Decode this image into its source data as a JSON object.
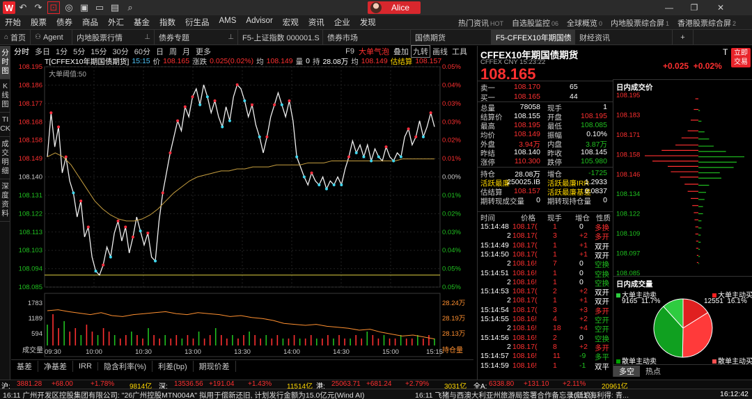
{
  "window": {
    "user_name": "Alice"
  },
  "menu": [
    "开始",
    "股票",
    "债券",
    "商品",
    "外汇",
    "基金",
    "指数",
    "衍生品",
    "AMS",
    "Advisor",
    "宏观",
    "资讯",
    "企业",
    "发现"
  ],
  "quick_links": [
    {
      "label": "热门资讯",
      "badge": "HOT"
    },
    {
      "label": "自选股监控",
      "badge": "06"
    },
    {
      "label": "全球概览",
      "badge": "0"
    },
    {
      "label": "内地股票综合屏",
      "badge": "1"
    },
    {
      "label": "香港股票综合屏",
      "badge": "2"
    }
  ],
  "tabs": [
    {
      "label": "首页",
      "icon": "home-icon"
    },
    {
      "label": "Agent",
      "icon": "user-icon"
    },
    {
      "label": "内地股票行情",
      "pin": true
    },
    {
      "label": "债券专题",
      "pin": true
    },
    {
      "label": "F5-上证指数 000001.S"
    },
    {
      "label": "债券市场"
    },
    {
      "label": "国债期货"
    },
    {
      "label": "F5-CFFEX10年期国债"
    },
    {
      "label": "财经资讯"
    }
  ],
  "vtabs": [
    "分时图",
    "K线图",
    "TICK",
    "成交明细",
    "深度资料"
  ],
  "periods": [
    "分时",
    "多日",
    "1分",
    "5分",
    "15分",
    "30分",
    "60分",
    "日",
    "周",
    "月",
    "更多"
  ],
  "chart_tools": [
    "F9",
    "大单气泡",
    "叠加",
    "九转",
    "画线",
    "工具"
  ],
  "info": {
    "symbol": "T[CFFEX10年期国债期货]",
    "time": "15:15",
    "price_label": "价",
    "price": "108.165",
    "chg_label": "涨跌",
    "chg": "0.025(0.02%)",
    "avg_label": "均",
    "avg": "108.149",
    "vol_label": "量",
    "vol": "0",
    "hold_label": "持",
    "hold": "28.08万",
    "settle_label": "均",
    "settle": "108.149",
    "est_label": "估结算",
    "est": "108.157",
    "big_threshold": "大单阈值:50"
  },
  "chart_data": {
    "type": "line",
    "ylabels": [
      "108.195",
      "108.186",
      "108.177",
      "108.168",
      "108.158",
      "108.149",
      "108.140",
      "108.131",
      "108.122",
      "108.113",
      "108.103",
      "108.094",
      "108.085"
    ],
    "pct_labels": [
      "0.05%",
      "0.04%",
      "0.03%",
      "0.03%",
      "0.02%",
      "0.01%",
      "0.00%",
      "0.01%",
      "0.02%",
      "0.03%",
      "0.04%",
      "0.05%",
      "0.05%"
    ],
    "ylim": [
      108.085,
      108.195
    ],
    "prev_close": 108.14,
    "low_line": 108.091,
    "x_labels": [
      "09:30",
      "10:00",
      "10:30",
      "13:00",
      "13:30",
      "14:00",
      "14:30",
      "15:00",
      "15:15"
    ],
    "price": [
      108.15,
      108.172,
      108.155,
      108.165,
      108.142,
      108.15,
      108.138,
      108.132,
      108.12,
      108.128,
      108.11,
      108.115,
      108.1,
      108.093,
      108.091,
      108.096,
      108.105,
      108.1,
      108.112,
      108.118,
      108.108,
      108.115,
      108.102,
      108.11,
      108.12,
      108.113,
      108.106,
      108.112,
      108.1,
      108.098,
      108.118,
      108.132,
      108.142,
      108.152,
      108.16,
      108.168,
      108.163,
      108.175,
      108.17,
      108.18,
      108.184,
      108.176,
      108.186,
      108.18,
      108.172,
      108.178,
      108.17,
      108.165,
      108.175,
      108.168,
      108.18,
      108.186,
      108.184,
      108.178,
      108.17,
      108.176,
      108.166,
      108.16,
      108.152,
      108.16,
      108.17,
      108.176,
      108.182,
      108.176,
      108.17,
      108.178,
      108.168,
      108.15,
      108.145,
      108.14,
      108.136,
      108.142,
      108.138,
      108.136,
      108.14,
      108.134,
      108.138,
      108.136,
      108.14,
      108.136,
      108.144,
      108.15,
      108.158,
      108.152,
      108.156,
      108.15,
      108.156,
      108.148,
      108.154,
      108.15,
      108.148,
      108.155,
      108.15,
      108.148,
      108.152,
      108.15,
      108.16,
      108.164,
      108.156,
      108.16,
      108.168,
      108.16,
      108.165,
      108.172,
      108.165
    ],
    "avg": [
      108.15,
      108.152,
      108.15,
      108.146,
      108.14,
      108.134,
      108.128,
      108.124,
      108.121,
      108.119,
      108.118,
      108.118,
      108.119,
      108.121,
      108.124,
      108.128,
      108.132,
      108.135,
      108.138,
      108.14,
      108.141,
      108.142,
      108.143,
      108.143,
      108.144,
      108.144,
      108.145,
      108.145,
      108.145,
      108.146,
      108.146,
      108.146,
      108.146,
      108.147,
      108.147,
      108.147,
      108.148,
      108.148,
      108.148,
      108.148,
      108.148,
      108.148,
      108.148,
      108.148,
      108.148,
      108.149,
      108.149,
      108.149,
      108.149,
      108.149
    ],
    "vol_ylabels": [
      "1783",
      "1189",
      "594"
    ],
    "hold_ylabels": [
      "28.24万",
      "28.19万",
      "28.13万"
    ],
    "vol_label": "成交量",
    "hold_label": "持仓量",
    "hold": [
      0.7,
      0.72,
      0.68,
      0.65,
      0.62,
      0.66,
      0.6,
      0.58,
      0.62,
      0.64,
      0.66,
      0.68,
      0.64,
      0.62,
      0.66,
      0.64,
      0.62,
      0.58,
      0.6,
      0.56,
      0.54,
      0.5,
      0.44,
      0.42,
      0.4,
      0.42,
      0.38,
      0.36,
      0.34,
      0.3,
      0.32,
      0.26,
      0.22,
      0.18,
      0.2,
      0.16,
      0.12
    ],
    "vol": [
      0.6,
      0.9,
      0.5,
      0.7,
      0.4,
      0.5,
      0.3,
      0.6,
      0.4,
      0.3,
      0.5,
      0.4,
      0.3,
      0.2,
      0.3,
      0.4,
      0.3,
      0.2,
      0.5,
      0.3,
      0.2,
      0.3,
      0.2,
      0.3,
      0.2,
      0.3,
      0.2,
      0.4,
      0.2,
      0.3,
      0.5,
      0.3,
      0.2,
      0.3,
      0.2,
      0.3,
      0.4,
      0.3,
      0.2,
      0.3,
      0.2,
      0.3,
      0.2,
      0.2,
      0.3,
      0.2,
      0.2,
      0.3,
      0.2,
      0.2,
      0.3,
      0.2,
      0.3,
      0.2,
      0.2,
      0.3,
      0.2,
      0.4,
      0.3,
      0.2,
      0.3,
      0.2,
      0.2,
      0.3,
      0.2,
      0.2,
      0.3,
      0.2,
      0.3,
      0.2
    ]
  },
  "bottom_tabs": [
    "基差",
    "净基差",
    "IRR",
    "隐含利率(%)",
    "利差(bp)",
    "期现价差"
  ],
  "quote": {
    "name": "CFFEX10年期国债期货",
    "sub": "CFFEX CNY 15:23:22",
    "price": "108.165",
    "t_label": "T",
    "chg": "+0.025",
    "chg_pct": "+0.02%",
    "trade_btn": "立即交易",
    "ask": {
      "label": "卖一",
      "price": "108.170",
      "vol": "65"
    },
    "bid": {
      "label": "买一",
      "price": "108.165",
      "vol": "44"
    },
    "stats": [
      [
        {
          "l": "总量",
          "v": "78058",
          "c": "white"
        },
        {
          "l": "现手",
          "v": "1",
          "c": "white"
        }
      ],
      [
        {
          "l": "结算价",
          "v": "108.155",
          "c": "white"
        },
        {
          "l": "开盘",
          "v": "108.195",
          "c": "red"
        }
      ],
      [
        {
          "l": "最高",
          "v": "108.195",
          "c": "red"
        },
        {
          "l": "最低",
          "v": "108.085",
          "c": "green"
        }
      ],
      [
        {
          "l": "均价",
          "v": "108.149",
          "c": "red"
        },
        {
          "l": "振幅",
          "v": "0.10%",
          "c": "white"
        }
      ],
      [
        {
          "l": "外盘",
          "v": "3.94万",
          "c": "red"
        },
        {
          "l": "内盘",
          "v": "3.87万",
          "c": "green"
        }
      ],
      [
        {
          "l": "昨结",
          "v": "108.140",
          "c": "white"
        },
        {
          "l": "昨收",
          "v": "108.145",
          "c": "white"
        }
      ],
      [
        {
          "l": "涨停",
          "v": "110.300",
          "c": "red"
        },
        {
          "l": "跌停",
          "v": "105.980",
          "c": "green"
        }
      ]
    ],
    "stats2": [
      [
        {
          "l": "持仓",
          "v": "28.08万",
          "c": "white"
        },
        {
          "l": "增仓",
          "v": "-1725",
          "c": "green"
        }
      ],
      [
        {
          "l": "活跃最廉",
          "v": "250025.IB",
          "c": "white",
          "lc": "yellow"
        },
        {
          "l": "活跃最廉IRR",
          "v": "1.2933",
          "c": "white",
          "lc": "yellow"
        }
      ],
      [
        {
          "l": "估结算",
          "v": "108.157",
          "c": "red"
        },
        {
          "l": "活跃最廉基差",
          "v": "0.0837",
          "c": "white",
          "lc": "yellow"
        }
      ],
      [
        {
          "l": "期转现成交量",
          "v": "0",
          "c": "white"
        },
        {
          "l": "期转现持仓量",
          "v": "0",
          "c": "white"
        }
      ]
    ],
    "tick_headers": [
      "时间",
      "价格",
      "现手",
      "增仓",
      "性质"
    ],
    "ticks": [
      {
        "t": "15:14:48",
        "p": "108.17(",
        "v": "1",
        "d": "0",
        "n": "多换",
        "nc": "red"
      },
      {
        "t": "2",
        "p": "108.17(",
        "v": "3",
        "d": "+2",
        "n": "多开",
        "nc": "red"
      },
      {
        "t": "15:14:49",
        "p": "108.17(",
        "v": "1",
        "d": "+1",
        "n": "双开",
        "nc": "white"
      },
      {
        "t": "15:14:50",
        "p": "108.17(",
        "v": "1",
        "d": "+1",
        "n": "双开",
        "nc": "white"
      },
      {
        "t": "2",
        "p": "108.16!",
        "v": "7",
        "d": "0",
        "n": "空换",
        "nc": "green"
      },
      {
        "t": "15:14:51",
        "p": "108.16!",
        "v": "1",
        "d": "0",
        "n": "空换",
        "nc": "green"
      },
      {
        "t": "2",
        "p": "108.16!",
        "v": "1",
        "d": "0",
        "n": "空换",
        "nc": "green"
      },
      {
        "t": "15:14:53",
        "p": "108.17(",
        "v": "2",
        "d": "+2",
        "n": "双开",
        "nc": "white"
      },
      {
        "t": "2",
        "p": "108.17(",
        "v": "1",
        "d": "+1",
        "n": "双开",
        "nc": "white"
      },
      {
        "t": "15:14:54",
        "p": "108.17(",
        "v": "3",
        "d": "+3",
        "n": "多开",
        "nc": "red"
      },
      {
        "t": "15:14:55",
        "p": "108.16!",
        "v": "4",
        "d": "+2",
        "n": "空开",
        "nc": "green"
      },
      {
        "t": "2",
        "p": "108.16!",
        "v": "18",
        "d": "+4",
        "n": "空开",
        "nc": "green"
      },
      {
        "t": "15:14:56",
        "p": "108.16!",
        "v": "2",
        "d": "0",
        "n": "空换",
        "nc": "green"
      },
      {
        "t": "2",
        "p": "108.17(",
        "v": "8",
        "d": "+2",
        "n": "多开",
        "nc": "red"
      },
      {
        "t": "15:14:57",
        "p": "108.16!",
        "v": "11",
        "d": "-9",
        "n": "多平",
        "nc": "green"
      },
      {
        "t": "15:14:59",
        "p": "108.16!",
        "v": "1",
        "d": "-1",
        "n": "双平",
        "nc": "white"
      }
    ]
  },
  "depth": {
    "title": "日内成交价",
    "labels": [
      "108.195",
      "108.183",
      "108.171",
      "108.158",
      "108.146",
      "108.134",
      "108.122",
      "108.109",
      "108.097",
      "108.085"
    ],
    "bars": [
      {
        "y": 0.02,
        "r": 4,
        "g": 0
      },
      {
        "y": 0.08,
        "r": 6,
        "g": 2
      },
      {
        "y": 0.14,
        "r": 10,
        "g": 4
      },
      {
        "y": 0.2,
        "r": 14,
        "g": 8
      },
      {
        "y": 0.24,
        "r": 22,
        "g": 14
      },
      {
        "y": 0.28,
        "r": 30,
        "g": 20
      },
      {
        "y": 0.31,
        "r": 48,
        "g": 36
      },
      {
        "y": 0.34,
        "r": 70,
        "g": 60
      },
      {
        "y": 0.37,
        "r": 60,
        "g": 50
      },
      {
        "y": 0.4,
        "r": 40,
        "g": 46
      },
      {
        "y": 0.43,
        "r": 36,
        "g": 28
      },
      {
        "y": 0.46,
        "r": 24,
        "g": 30
      },
      {
        "y": 0.5,
        "r": 18,
        "g": 14
      },
      {
        "y": 0.54,
        "r": 14,
        "g": 10
      },
      {
        "y": 0.58,
        "r": 10,
        "g": 8
      },
      {
        "y": 0.62,
        "r": 8,
        "g": 6
      },
      {
        "y": 0.66,
        "r": 6,
        "g": 6
      },
      {
        "y": 0.7,
        "r": 5,
        "g": 4
      },
      {
        "y": 0.74,
        "r": 4,
        "g": 4
      },
      {
        "y": 0.78,
        "r": 4,
        "g": 3
      },
      {
        "y": 0.82,
        "r": 3,
        "g": 3
      },
      {
        "y": 0.86,
        "r": 3,
        "g": 2
      },
      {
        "y": 0.9,
        "r": 2,
        "g": 2
      },
      {
        "y": 0.94,
        "r": 2,
        "g": 1
      }
    ]
  },
  "pie": {
    "title": "日内成交量",
    "big_sell": {
      "label": "大单主动卖",
      "vol": "9165",
      "pct": "11.7%"
    },
    "big_buy": {
      "label": "大单主动买",
      "vol": "12551",
      "pct": "16.1%"
    },
    "small_sell": {
      "label": "散单主动卖"
    },
    "small_buy": {
      "label": "散单主动买"
    },
    "slices": [
      0.117,
      0.161,
      0.38,
      0.342
    ],
    "tabs": [
      "多空",
      "热点"
    ]
  },
  "status": [
    {
      "k": "沪:",
      "v": "3881.28",
      "c": "red"
    },
    {
      "v": "+68.00",
      "c": "red"
    },
    {
      "v": "+1.78%",
      "c": "red"
    },
    {
      "v": "9814亿",
      "c": "yellow"
    },
    {
      "k": "深:",
      "v": "13536.56",
      "c": "red"
    },
    {
      "v": "+191.04",
      "c": "red"
    },
    {
      "v": "+1.43%",
      "c": "red"
    },
    {
      "v": "11514亿",
      "c": "yellow"
    },
    {
      "k": "港:",
      "v": "25063.71",
      "c": "red"
    },
    {
      "v": "+681.24",
      "c": "red"
    },
    {
      "v": "+2.79%",
      "c": "red"
    },
    {
      "v": "3031亿",
      "c": "yellow"
    },
    {
      "k": "全A:",
      "v": "6338.80",
      "c": "red"
    },
    {
      "v": "+131.10",
      "c": "red"
    },
    {
      "v": "+2.11%",
      "c": "red"
    },
    {
      "v": "20961亿",
      "c": "yellow"
    }
  ],
  "news": [
    "16:11  广州开发区控股集团有限公司:  \"26广州控股MTN004A\" 拟用于偿新还旧, 计划发行金额为15.0亿元(Wind AI)",
    "16:11  飞猪与西澳大利亚州旅游局签署合作备忘录(新浪)",
    "16:11  海利得: 青..."
  ],
  "clock": "16:12:42"
}
